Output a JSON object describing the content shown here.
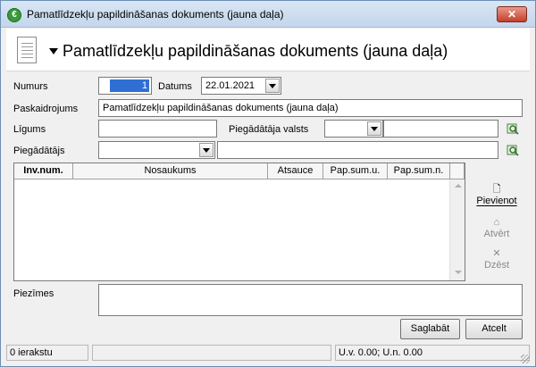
{
  "window": {
    "title": "Pamatlīdzekļu papildināšanas dokuments (jauna daļa)",
    "close_label": "✕"
  },
  "header": {
    "title": "Pamatlīdzekļu papildināšanas dokuments (jauna daļa)"
  },
  "form": {
    "numurs_label": "Numurs",
    "numurs_value": "1",
    "datums_label": "Datums",
    "datums_value": "22.01.2021",
    "paskaidrojums_label": "Paskaidrojums",
    "paskaidrojums_value": "Pamatlīdzekļu papildināšanas dokuments (jauna daļa)",
    "ligums_label": "Līgums",
    "ligums_value": "",
    "piegadataja_valsts_label": "Piegādātāja valsts",
    "piegadataja_valsts_value": "",
    "piegadataja_valsts_name": "",
    "piegadatajs_label": "Piegādātājs",
    "piegadatajs_value": "",
    "piegadatajs_name": "",
    "piezimes_label": "Piezīmes",
    "piezimes_value": ""
  },
  "grid": {
    "columns": [
      "Inv.num.",
      "Nosaukums",
      "Atsauce",
      "Pap.sum.u.",
      "Pap.sum.n."
    ],
    "rows": []
  },
  "side_buttons": {
    "add": "Pievienot",
    "open": "Atvērt",
    "delete": "Dzēst"
  },
  "buttons": {
    "save": "Saglabāt",
    "cancel": "Atcelt"
  },
  "status": {
    "records": "0 ierakstu",
    "middle": "",
    "sums": "U.v. 0.00; U.n. 0.00"
  },
  "colors": {
    "selection": "#2f6fd4",
    "titlebar": "#c4d6ec"
  }
}
